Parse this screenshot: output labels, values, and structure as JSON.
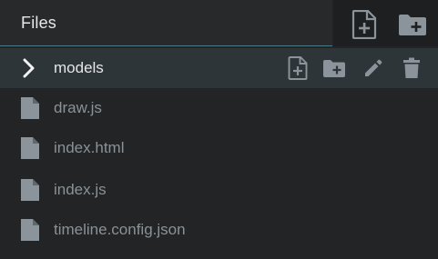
{
  "header": {
    "title": "Files",
    "new_file_icon": "file-plus-icon",
    "new_folder_icon": "folder-plus-icon"
  },
  "selected_folder": {
    "label": "models",
    "expand_icon": "chevron-right-icon",
    "actions": [
      "file-plus-icon",
      "folder-plus-icon",
      "pencil-icon",
      "trash-icon"
    ]
  },
  "files": [
    {
      "label": "draw.js"
    },
    {
      "label": "index.html"
    },
    {
      "label": "index.js"
    },
    {
      "label": "timeline.config.json"
    }
  ],
  "colors": {
    "background": "#222426",
    "header_active": "#27292b",
    "accent_line": "#4e7a87",
    "selected_row": "#2e3538",
    "icon": "#8a949a",
    "text_primary": "#e4e6e8",
    "text_muted": "#8a9297"
  }
}
